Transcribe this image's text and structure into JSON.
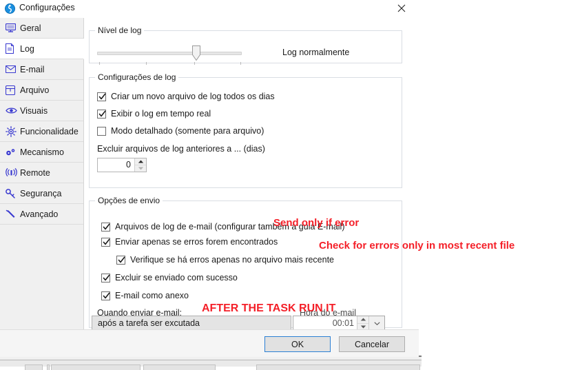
{
  "window": {
    "title": "Configurações",
    "app_icon": "settings-globe-icon",
    "close_icon": "close-icon"
  },
  "sidebar": {
    "items": [
      {
        "label": "Geral",
        "icon": "monitor-icon",
        "selected": false
      },
      {
        "label": "Log",
        "icon": "document-icon",
        "selected": true
      },
      {
        "label": "E-mail",
        "icon": "envelope-icon",
        "selected": false
      },
      {
        "label": "Arquivo",
        "icon": "archive-icon",
        "selected": false
      },
      {
        "label": "Visuais",
        "icon": "eye-icon",
        "selected": false
      },
      {
        "label": "Funcionalidade",
        "icon": "gear-sun-icon",
        "selected": false
      },
      {
        "label": "Mecanismo",
        "icon": "cogs-icon",
        "selected": false
      },
      {
        "label": "Remote",
        "icon": "antenna-icon",
        "selected": false
      },
      {
        "label": "Segurança",
        "icon": "key-icon",
        "selected": false
      },
      {
        "label": "Avançado",
        "icon": "wrench-icon",
        "selected": false
      }
    ]
  },
  "log_level": {
    "group_title": "Nível de log",
    "value_label": "Log normalmente",
    "slider": {
      "min": 0,
      "max": 3,
      "value": 2,
      "ticks": 4,
      "thumb_percent": 66
    }
  },
  "log_settings": {
    "group_title": "Configurações de log",
    "checkboxes": [
      {
        "label": "Criar um novo arquivo de log todos os dias",
        "checked": true
      },
      {
        "label": "Exibir o log em tempo real",
        "checked": true
      },
      {
        "label": "Modo detalhado (somente para arquivo)",
        "checked": false
      }
    ],
    "delete_label": "Excluir arquivos de log anteriores a ... (dias)",
    "delete_days": "0",
    "spinner_up_icon": "spinner-up-icon",
    "spinner_down_icon": "spinner-down-icon"
  },
  "send_options": {
    "group_title": "Opções de envio",
    "checkboxes": [
      {
        "label": "Arquivos de log de e-mail (configurar também a guia E-mail)",
        "checked": true,
        "indent": false
      },
      {
        "label": "Enviar apenas se erros forem encontrados",
        "checked": true,
        "indent": false
      },
      {
        "label": "Verifique se há erros apenas no arquivo mais recente",
        "checked": true,
        "indent": true
      },
      {
        "label": "Excluir se enviado com sucesso",
        "checked": true,
        "indent": false
      },
      {
        "label": "E-mail como anexo",
        "checked": true,
        "indent": false
      }
    ],
    "when_label": "Quando enviar e-mail:",
    "when_value": "após a tarefa ser excutada",
    "time_label": "Hora do e-mail",
    "time_value": "00:01",
    "dropdown_icon": "chevron-down-icon"
  },
  "annotations": [
    {
      "id": "annot-send",
      "text": "Send only if error"
    },
    {
      "id": "annot-check",
      "text": "Check for errors only in most recent file"
    },
    {
      "id": "annot-after",
      "text": "AFTER THE TASK RUN  IT"
    }
  ],
  "footer": {
    "ok_label": "OK",
    "cancel_label": "Cancelar"
  },
  "colors": {
    "annotation_red": "#f41f28",
    "accent_blue": "#2a7fd4",
    "icon_blue": "#3a3ad0",
    "sidebar_bg": "#f0f0f0"
  }
}
